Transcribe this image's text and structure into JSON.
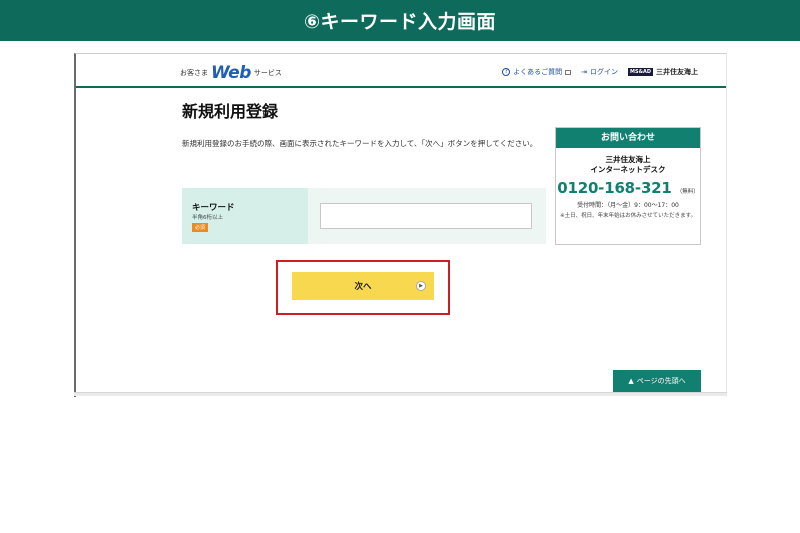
{
  "banner": {
    "title": "⑥キーワード入力画面"
  },
  "header": {
    "brand_prefix": "お客さま",
    "brand_logo": "Web",
    "brand_suffix": "サービス",
    "faq_link": "よくあるご質問",
    "login_link": "ログイン",
    "company_badge": "MS&AD",
    "company_name": "三井住友海上"
  },
  "main": {
    "title": "新規利用登録",
    "instruction": "新規利用登録のお手続の際、画面に表示されたキーワードを入力して、「次へ」ボタンを押してください。"
  },
  "keyword_form": {
    "label": "キーワード",
    "note": "半角6桁以上",
    "required_badge": "必須",
    "input_value": "",
    "input_placeholder": ""
  },
  "next_button": {
    "label": "次へ"
  },
  "contact": {
    "heading": "お問い合わせ",
    "org_line1": "三井住友海上",
    "org_line2": "インターネットデスク",
    "phone": "0120-168-321",
    "phone_note": "（無料）",
    "hours": "受付時間：（月～金）9：00～17：00",
    "note": "※土日、祝日、年末年始はお休みさせていただきます。"
  },
  "page_top_button": {
    "label": "ページの先頭へ"
  },
  "colors": {
    "accent": "#0e6a5b",
    "button": "#f7d84e",
    "highlight": "#cc1f1f",
    "required": "#f08a1e"
  },
  "icons": {
    "faq": "question-circle-icon",
    "external": "external-link-icon",
    "login": "login-arrow-icon",
    "next": "chevron-right-icon",
    "top": "caret-up-icon"
  }
}
